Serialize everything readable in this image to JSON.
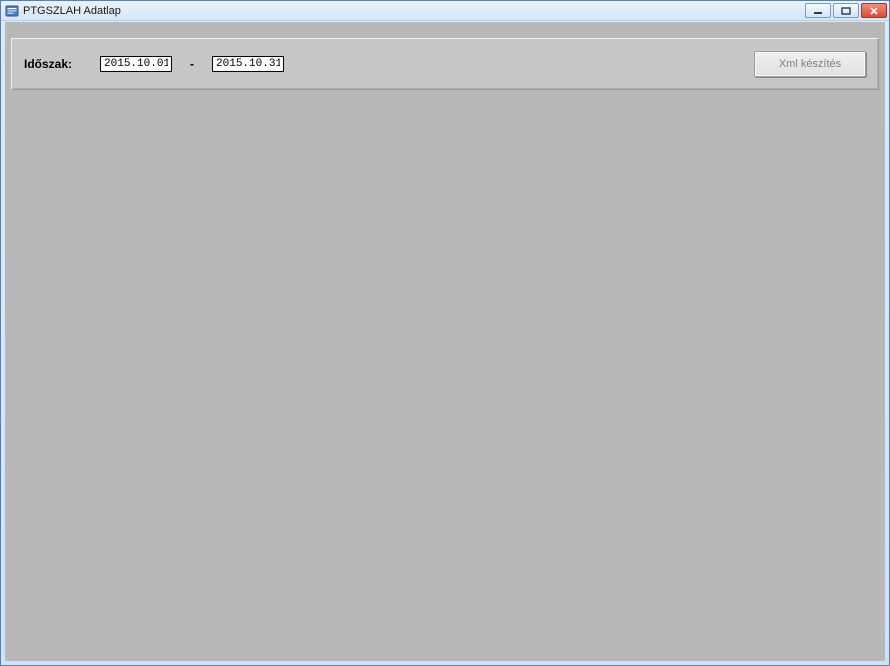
{
  "window": {
    "title": "PTGSZLAH Adatlap"
  },
  "toolbar": {
    "period_label": "Időszak:",
    "date_from": "2015.10.01",
    "date_to": "2015.10.31",
    "separator": "-",
    "xml_button": "Xml készítés"
  }
}
